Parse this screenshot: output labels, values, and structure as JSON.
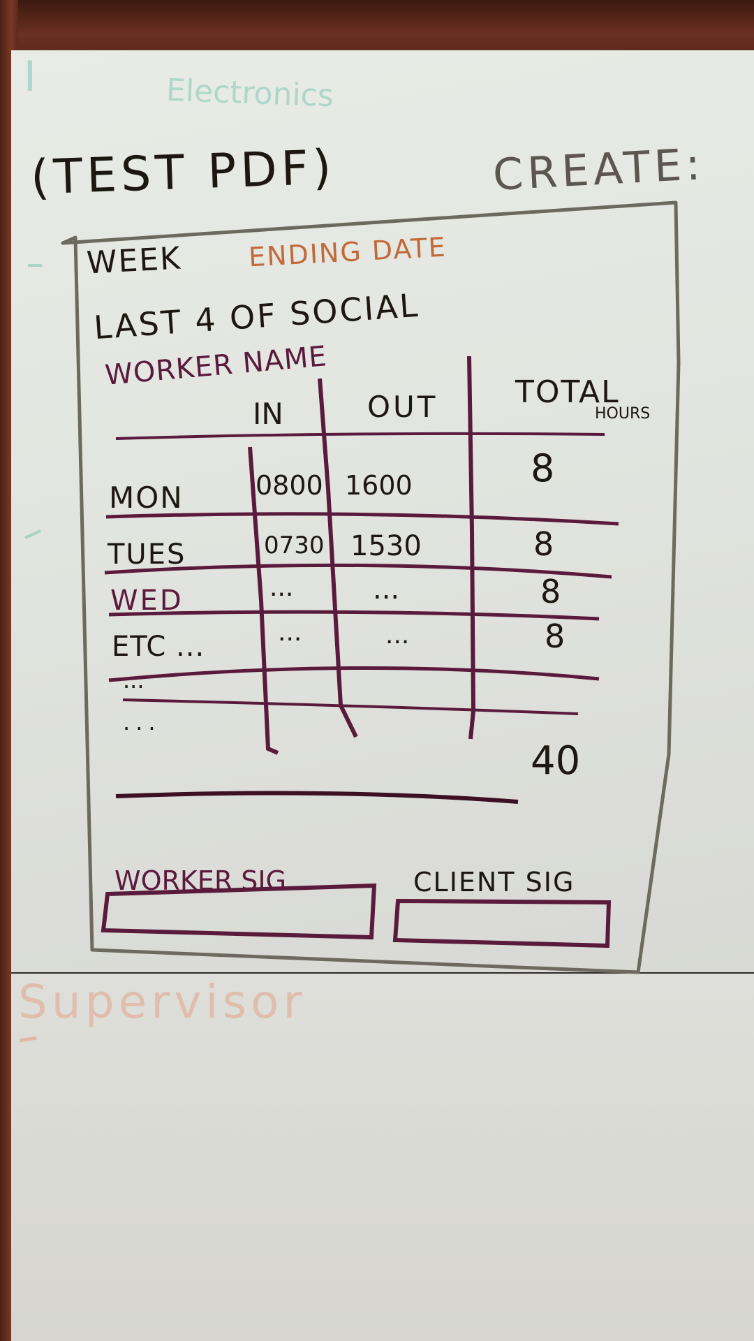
{
  "ghost_text": {
    "electronics": "Electronics",
    "lower_smudge": "Supervisor"
  },
  "heading": {
    "test_pdf": "(TEST PDF)",
    "create": "CREATE:"
  },
  "form_fields": {
    "week_ending_part1": "WEEK",
    "week_ending_part2": "ENDING DATE",
    "last4": "LAST 4 OF SOCIAL",
    "worker_name": "WORKER NAME"
  },
  "table": {
    "headers": {
      "in": "IN",
      "out": "OUT",
      "total": "TOTAL",
      "hours": "HOURS"
    },
    "rows": [
      {
        "day": "MON",
        "in": "0800",
        "out": "1600",
        "total": "8"
      },
      {
        "day": "TUES",
        "in": "0730",
        "out": "1530",
        "total": "8"
      },
      {
        "day": "WED",
        "in": "...",
        "out": "...",
        "total": "8"
      },
      {
        "day": "ETC ...",
        "in": "...",
        "out": "...",
        "total": "8"
      }
    ],
    "extra_rows": [
      "...",
      "..."
    ],
    "sum_total": "40"
  },
  "signatures": {
    "worker": "WORKER SIG",
    "client": "CLIENT SIG"
  },
  "colors": {
    "board": "#e5e6e1",
    "frame": "#5a2a1c",
    "black_marker": "#1d1712",
    "purple_marker": "#5a1a3c",
    "orange_marker": "#c2693a",
    "ghost_teal": "#7fc8b6"
  }
}
